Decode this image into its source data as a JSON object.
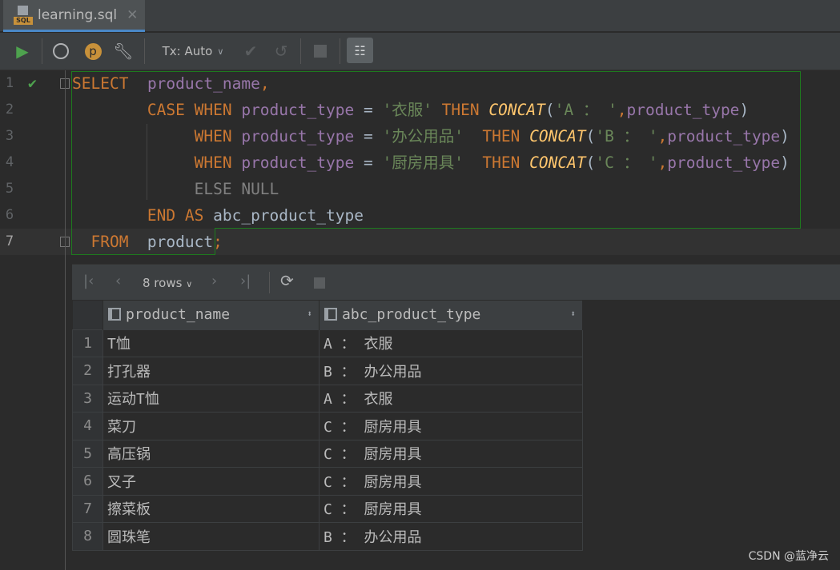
{
  "tab": {
    "title": "learning.sql",
    "icon": "sql-file-icon",
    "icon_label": "SQL"
  },
  "toolbar": {
    "tx_mode": "Tx: Auto",
    "p_label": "p"
  },
  "editor": {
    "lines": [
      {
        "n": "1",
        "tokens": [
          [
            "k",
            "SELECT"
          ],
          [
            "p",
            "  "
          ],
          [
            "c",
            "product_name"
          ],
          [
            "k",
            ","
          ]
        ]
      },
      {
        "n": "2",
        "tokens": [
          [
            "p",
            "        "
          ],
          [
            "k",
            "CASE WHEN "
          ],
          [
            "c",
            "product_type"
          ],
          [
            "p",
            " = "
          ],
          [
            "s",
            "'衣服'"
          ],
          [
            "k",
            " THEN "
          ],
          [
            "f",
            "CONCAT"
          ],
          [
            "p",
            "("
          ],
          [
            "s",
            "'A ： '"
          ],
          [
            "k",
            ","
          ],
          [
            "c",
            "product_type"
          ],
          [
            "p",
            ")"
          ]
        ]
      },
      {
        "n": "3",
        "tokens": [
          [
            "p",
            "             "
          ],
          [
            "k",
            "WHEN "
          ],
          [
            "c",
            "product_type"
          ],
          [
            "p",
            " = "
          ],
          [
            "s",
            "'办公用品'"
          ],
          [
            "k",
            "  THEN "
          ],
          [
            "f",
            "CONCAT"
          ],
          [
            "p",
            "("
          ],
          [
            "s",
            "'B ： '"
          ],
          [
            "k",
            ","
          ],
          [
            "c",
            "product_type"
          ],
          [
            "p",
            ")"
          ]
        ]
      },
      {
        "n": "4",
        "tokens": [
          [
            "p",
            "             "
          ],
          [
            "k",
            "WHEN "
          ],
          [
            "c",
            "product_type"
          ],
          [
            "p",
            " = "
          ],
          [
            "s",
            "'厨房用具'"
          ],
          [
            "k",
            "  THEN "
          ],
          [
            "f",
            "CONCAT"
          ],
          [
            "p",
            "("
          ],
          [
            "s",
            "'C ： '"
          ],
          [
            "k",
            ","
          ],
          [
            "c",
            "product_type"
          ],
          [
            "p",
            ")"
          ]
        ]
      },
      {
        "n": "5",
        "tokens": [
          [
            "p",
            "             "
          ],
          [
            "g",
            "ELSE NULL"
          ]
        ]
      },
      {
        "n": "6",
        "tokens": [
          [
            "p",
            "        "
          ],
          [
            "k",
            "END AS "
          ],
          [
            "p",
            "abc_product_type"
          ]
        ]
      },
      {
        "n": "7",
        "tokens": [
          [
            "p",
            "  "
          ],
          [
            "k",
            "FROM"
          ],
          [
            "p",
            "  product"
          ],
          [
            "k",
            ";"
          ]
        ]
      }
    ]
  },
  "results": {
    "rows_label": "8 rows",
    "columns": [
      "product_name",
      "abc_product_type"
    ],
    "rows": [
      [
        "1",
        "T恤",
        "A ：  衣服"
      ],
      [
        "2",
        "打孔器",
        "B ：  办公用品"
      ],
      [
        "3",
        "运动T恤",
        "A ：  衣服"
      ],
      [
        "4",
        "菜刀",
        "C ：  厨房用具"
      ],
      [
        "5",
        "高压锅",
        "C ：  厨房用具"
      ],
      [
        "6",
        "叉子",
        "C ：  厨房用具"
      ],
      [
        "7",
        "擦菜板",
        "C ：  厨房用具"
      ],
      [
        "8",
        "圆珠笔",
        "B ：  办公用品"
      ]
    ]
  },
  "watermark": "CSDN @蓝净云",
  "colors": {
    "keyword": "#cc7832",
    "column": "#9876aa",
    "string": "#6a8759",
    "function": "#ffc66d",
    "selection_border": "#1e7a1e",
    "tab_accent": "#4a88c7"
  }
}
